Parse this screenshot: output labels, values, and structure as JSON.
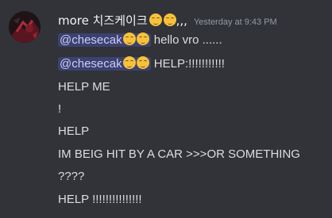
{
  "message": {
    "author": {
      "name": "more 치즈케이크",
      "name_suffix": ",,,",
      "emoji_count": 2
    },
    "timestamp": "Yesterday at 9:43 PM",
    "lines": [
      {
        "mention": "@chesecak",
        "text": " hello vro ......"
      },
      {
        "mention": "@chesecak",
        "text": " HELP:!!!!!!!!!!!"
      },
      {
        "text": "HELP ME"
      },
      {
        "text": "!"
      },
      {
        "text": "HELP"
      },
      {
        "text": "IM BEIG HIT BY A CAR >>>OR SOMETHING"
      },
      {
        "text": "????"
      },
      {
        "text": "HELP !!!!!!!!!!!!!!!"
      }
    ]
  },
  "colors": {
    "background": "#313338",
    "mention_bg": "#3c4270",
    "mention_text": "#c9cdfb",
    "text": "#dbdee1",
    "timestamp": "#949ba4"
  }
}
